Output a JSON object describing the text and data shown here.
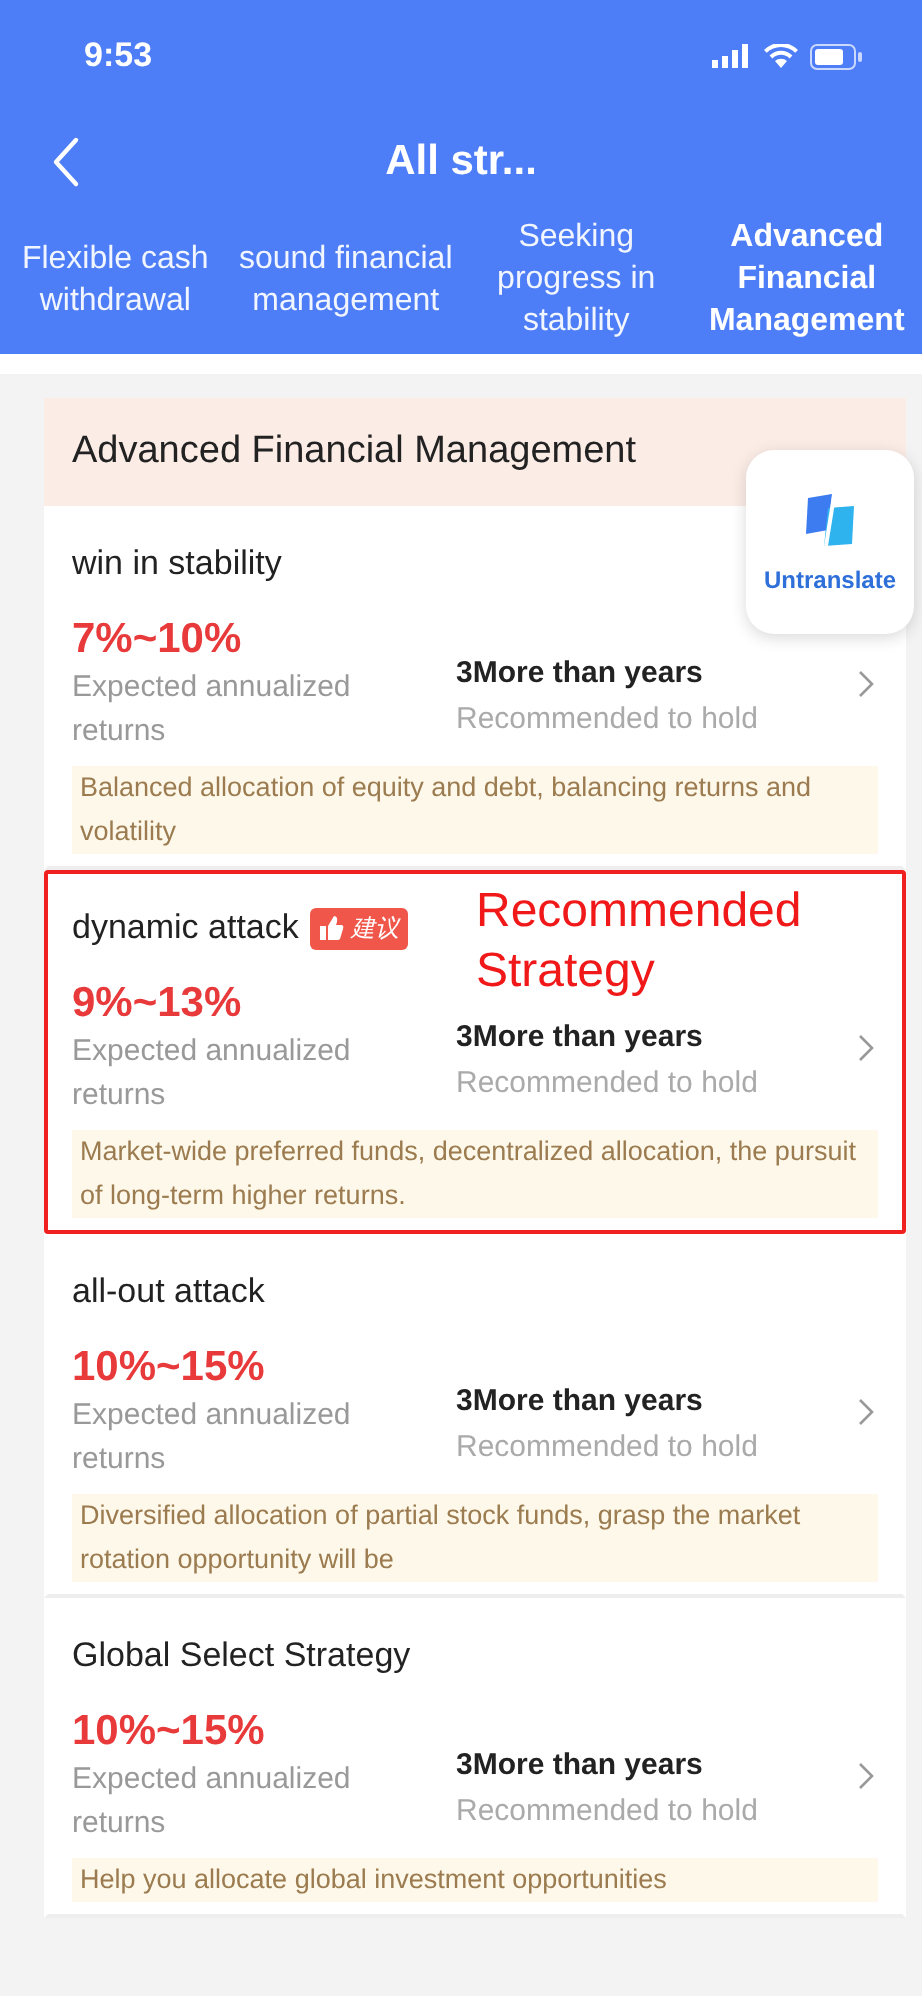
{
  "status_bar": {
    "time": "9:53"
  },
  "nav": {
    "title": "All str..."
  },
  "tabs": [
    {
      "label": "Flexible cash withdrawal",
      "selected": false
    },
    {
      "label": "sound financial management",
      "selected": false
    },
    {
      "label": "Seeking progress in stability",
      "selected": false
    },
    {
      "label": "Advanced Financial Management",
      "selected": true
    }
  ],
  "section": {
    "title": "Advanced Financial Management"
  },
  "floating_button": {
    "label": "Untranslate"
  },
  "annotation": {
    "label": "Recommended Strategy"
  },
  "strategies": [
    {
      "name": "win in stability",
      "highlighted": false,
      "rate": "7%~10%",
      "rate_label": "Expected annualized returns",
      "hold": "3More than years",
      "hold_label": "Recommended to hold",
      "description": "Balanced allocation of equity and debt, balancing returns and volatility"
    },
    {
      "name": "dynamic attack",
      "badge": "建议",
      "highlighted": true,
      "rate": "9%~13%",
      "rate_label": "Expected annualized returns",
      "hold": "3More than years",
      "hold_label": "Recommended to hold",
      "description": "Market-wide preferred funds, decentralized allocation, the pursuit of long-term higher returns."
    },
    {
      "name": "all-out attack",
      "highlighted": false,
      "rate": "10%~15%",
      "rate_label": "Expected annualized returns",
      "hold": "3More than years",
      "hold_label": "Recommended to hold",
      "description": "Diversified allocation of partial stock funds, grasp the market rotation opportunity will be"
    },
    {
      "name": "Global Select Strategy",
      "highlighted": false,
      "rate": "10%~15%",
      "rate_label": "Expected annualized returns",
      "hold": "3More than years",
      "hold_label": "Recommended to hold",
      "description": "Help you allocate global investment opportunities"
    }
  ]
}
